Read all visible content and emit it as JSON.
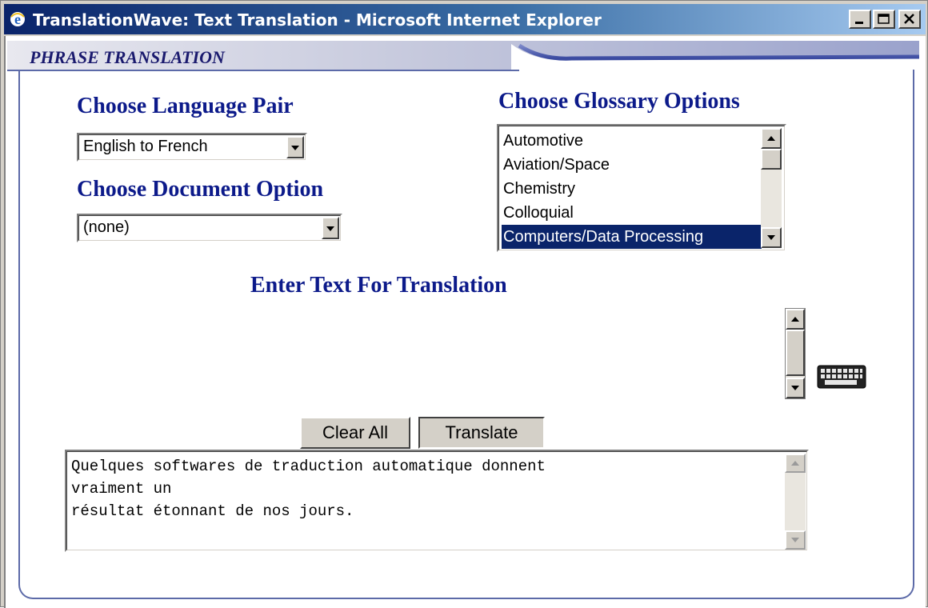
{
  "window": {
    "title": "TranslationWave: Text Translation - Microsoft Internet Explorer",
    "app_icon": "internet-explorer-icon",
    "controls": [
      "minimize-icon",
      "maximize-icon",
      "close-icon"
    ]
  },
  "header": {
    "title": "PHRASE TRANSLATION"
  },
  "language_pair": {
    "heading": "Choose Language Pair",
    "selected": "English to French"
  },
  "document_option": {
    "heading": "Choose Document Option",
    "selected": "(none)"
  },
  "glossary": {
    "heading": "Choose Glossary Options",
    "options": [
      "Automotive",
      "Aviation/Space",
      "Chemistry",
      "Colloquial",
      "Computers/Data Processing"
    ],
    "selected": "Computers/Data Processing"
  },
  "input": {
    "heading": "Enter  Text For Translation",
    "value": ""
  },
  "keyboard": {
    "icon": "keyboard-icon"
  },
  "buttons": {
    "clear_all": "Clear All",
    "translate": "Translate"
  },
  "output": {
    "lines": [
      "Quelques softwares de traduction automatique donnent",
      "vraiment un",
      "résultat étonnant de nos jours."
    ]
  },
  "colors": {
    "heading": "#0c1a8a",
    "selection": "#0a246a",
    "titlebar": "#0a246a"
  }
}
